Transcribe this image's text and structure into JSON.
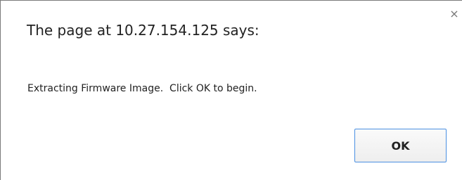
{
  "dialog": {
    "title": "The page at 10.27.154.125 says:",
    "message": "Extracting Firmware Image.  Click OK to begin.",
    "ok_label": "OK",
    "close_glyph": "×"
  }
}
